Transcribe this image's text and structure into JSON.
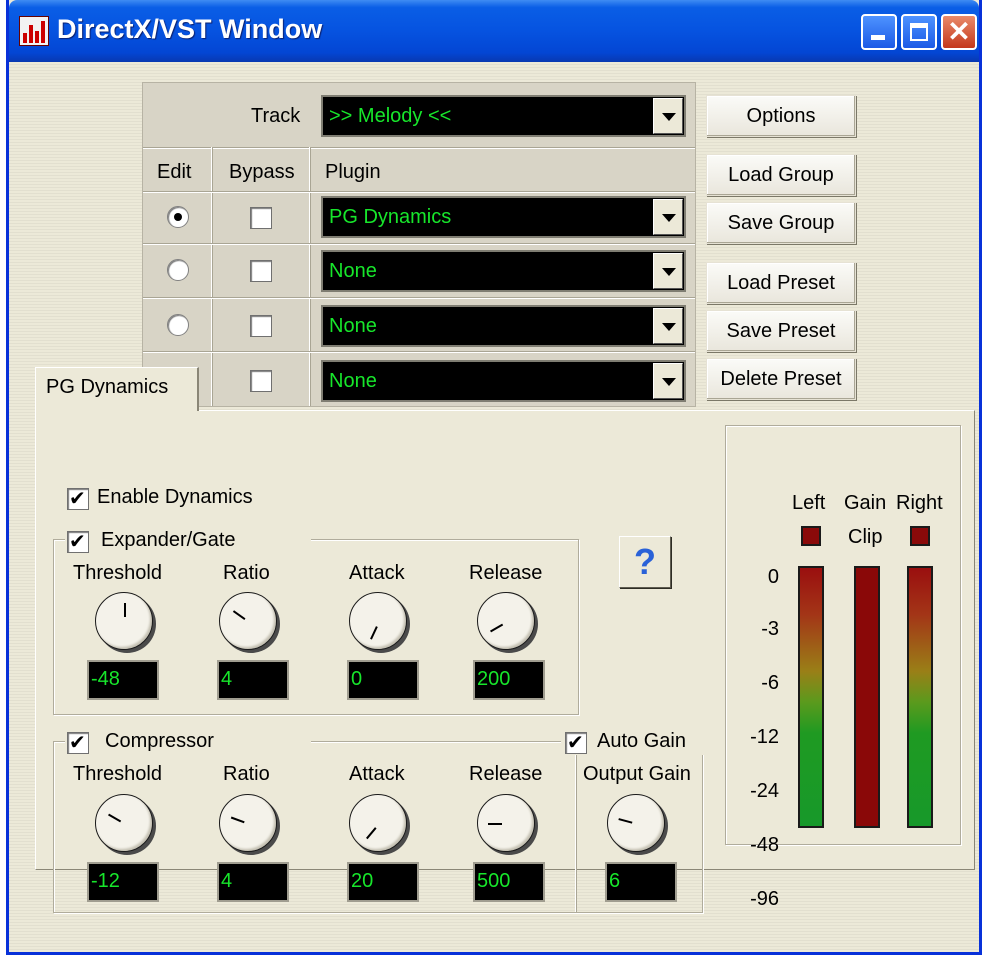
{
  "window": {
    "title": "DirectX/VST Window",
    "controls": [
      "minimize-icon",
      "maximize-icon",
      "close-icon"
    ],
    "close_glyph": "✕"
  },
  "plugin_chain": {
    "track_label": "Track",
    "track_value": ">> Melody <<",
    "headers": {
      "edit": "Edit",
      "bypass": "Bypass",
      "plugin": "Plugin"
    },
    "slots": [
      {
        "edit_selected": true,
        "bypass": false,
        "plugin": "PG Dynamics"
      },
      {
        "edit_selected": false,
        "bypass": false,
        "plugin": "None"
      },
      {
        "edit_selected": false,
        "bypass": false,
        "plugin": "None"
      },
      {
        "edit_selected": false,
        "bypass": false,
        "plugin": "None"
      }
    ]
  },
  "buttons": {
    "options": "Options",
    "load_group": "Load Group",
    "save_group": "Save Group",
    "load_preset": "Load Preset",
    "save_preset": "Save Preset",
    "delete_preset": "Delete Preset"
  },
  "tab": {
    "label": "PG Dynamics"
  },
  "dynamics": {
    "enable_label": "Enable Dynamics",
    "enable_checked": true,
    "expander": {
      "label": "Expander/Gate",
      "checked": true,
      "threshold_label": "Threshold",
      "threshold": "-48",
      "ratio_label": "Ratio",
      "ratio": "4",
      "attack_label": "Attack",
      "attack": "0",
      "release_label": "Release",
      "release": "200"
    },
    "compressor": {
      "label": "Compressor",
      "checked": true,
      "threshold_label": "Threshold",
      "threshold": "-12",
      "ratio_label": "Ratio",
      "ratio": "4",
      "attack_label": "Attack",
      "attack": "20",
      "release_label": "Release",
      "release": "500"
    },
    "auto_gain_label": "Auto Gain",
    "auto_gain_checked": true,
    "output_gain_label": "Output Gain",
    "output_gain": "6",
    "help_glyph": "?"
  },
  "meters": {
    "left_label": "Left",
    "gain_label": "Gain",
    "right_label": "Right",
    "clip_label": "Clip",
    "scale": [
      "0",
      "-3",
      "-6",
      "-12",
      "-24",
      "-48",
      "-96"
    ]
  },
  "colors": {
    "lcd_text": "#17e62b",
    "clip_led": "#8a0a0a",
    "titlebar": "#0653e0"
  }
}
